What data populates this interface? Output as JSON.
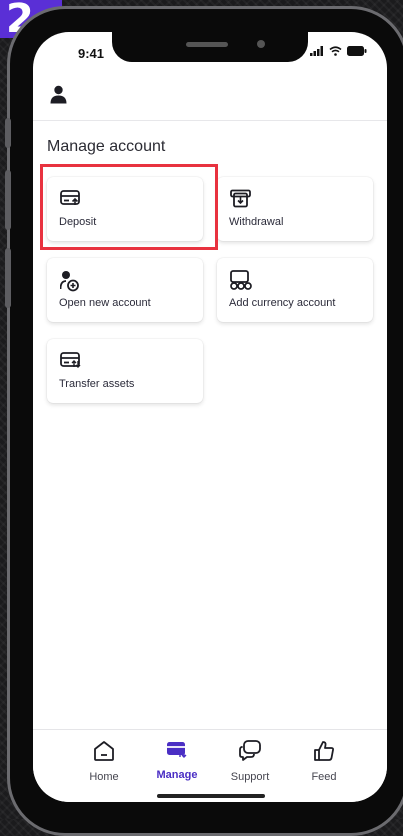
{
  "step_badge": "2",
  "status_bar": {
    "time": "9:41"
  },
  "header": {
    "avatar_icon": "user-icon"
  },
  "section_title": "Manage account",
  "cards": [
    {
      "label": "Deposit",
      "icon": "deposit-card-icon",
      "highlighted": true
    },
    {
      "label": "Withdrawal",
      "icon": "withdrawal-icon",
      "highlighted": false
    },
    {
      "label": "Open new account",
      "icon": "open-account-icon",
      "highlighted": false
    },
    {
      "label": "Add currency account",
      "icon": "currency-account-icon",
      "highlighted": false
    },
    {
      "label": "Transfer assets",
      "icon": "transfer-assets-icon",
      "highlighted": false
    }
  ],
  "tabs": [
    {
      "label": "Home",
      "icon": "home-icon",
      "active": false
    },
    {
      "label": "Manage",
      "icon": "manage-icon",
      "active": true
    },
    {
      "label": "Support",
      "icon": "support-icon",
      "active": false
    },
    {
      "label": "Feed",
      "icon": "thumbs-up-icon",
      "active": false
    }
  ],
  "colors": {
    "accent": "#4a2ec4",
    "highlight_border": "#e8323f",
    "badge": "#5a2fd6"
  }
}
